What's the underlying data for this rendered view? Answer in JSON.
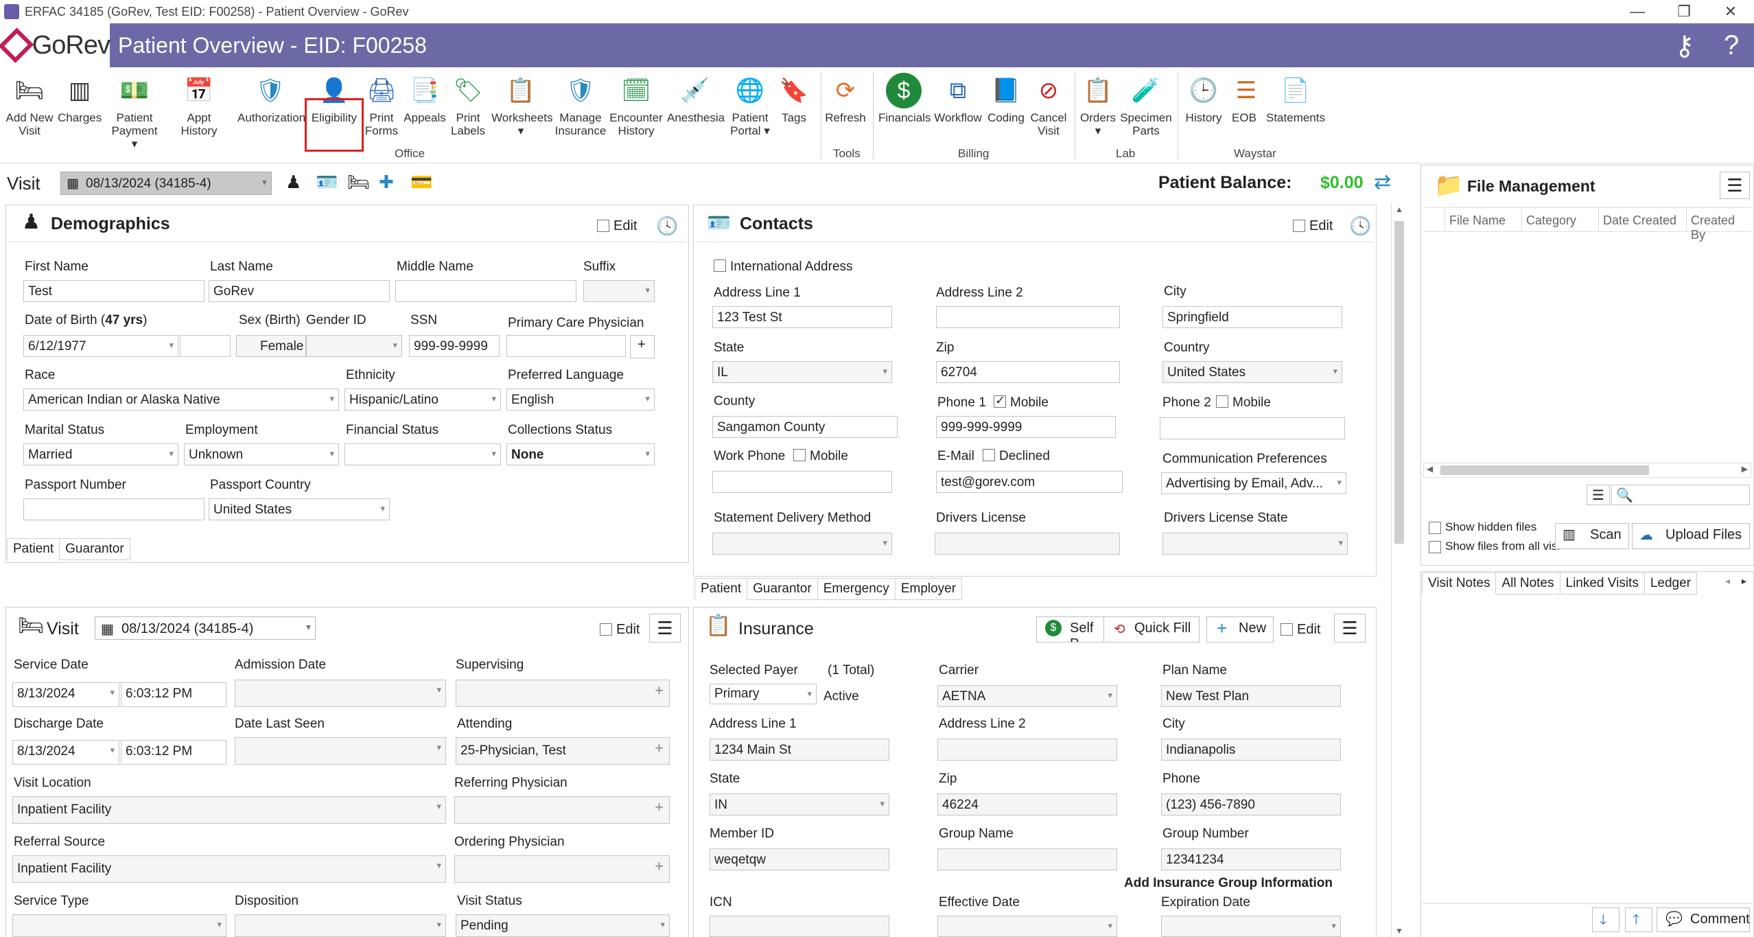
{
  "window": {
    "title": "ERFAC 34185 (GoRev, Test EID: F00258) - Patient Overview - GoRev",
    "minimize": "—",
    "restore": "❐",
    "close": "✕"
  },
  "header": {
    "logo": "GoRev",
    "title": "Patient Overview - EID: F00258"
  },
  "ribbon": {
    "office": [
      {
        "key": "add_new_visit",
        "label": "Add New Visit"
      },
      {
        "key": "charges",
        "label": "Charges"
      },
      {
        "key": "patient_payment",
        "label": "Patient Payment"
      },
      {
        "key": "appt_history",
        "label": "Appt History"
      },
      {
        "key": "authorization",
        "label": "Authorization"
      },
      {
        "key": "eligibility",
        "label": "Eligibility"
      },
      {
        "key": "print_forms",
        "label": "Print Forms"
      },
      {
        "key": "appeals",
        "label": "Appeals"
      },
      {
        "key": "print_labels",
        "label": "Print Labels"
      },
      {
        "key": "worksheets",
        "label": "Worksheets"
      },
      {
        "key": "manage_insurance",
        "label": "Manage Insurance"
      },
      {
        "key": "encounter_history",
        "label": "Encounter History"
      },
      {
        "key": "anesthesia",
        "label": "Anesthesia"
      },
      {
        "key": "patient_portal",
        "label": "Patient Portal"
      },
      {
        "key": "tags",
        "label": "Tags"
      }
    ],
    "tools": [
      {
        "key": "refresh",
        "label": "Refresh"
      }
    ],
    "billing": [
      {
        "key": "financials",
        "label": "Financials"
      },
      {
        "key": "workflow",
        "label": "Workflow"
      },
      {
        "key": "coding",
        "label": "Coding"
      },
      {
        "key": "cancel_visit",
        "label": "Cancel Visit"
      }
    ],
    "lab": [
      {
        "key": "orders",
        "label": "Orders"
      },
      {
        "key": "specimen_parts",
        "label": "Specimen Parts"
      }
    ],
    "waystar": [
      {
        "key": "history",
        "label": "History"
      },
      {
        "key": "eob",
        "label": "EOB"
      },
      {
        "key": "statements",
        "label": "Statements"
      }
    ],
    "groups": {
      "office": "Office",
      "tools": "Tools",
      "billing": "Billing",
      "lab": "Lab",
      "waystar": "Waystar"
    }
  },
  "visitbar": {
    "label": "Visit",
    "selected": "08/13/2024 (34185-4)",
    "balance_label": "Patient Balance:",
    "balance_value": "$0.00"
  },
  "demographics": {
    "title": "Demographics",
    "edit": "Edit",
    "first_name_label": "First Name",
    "first_name": "Test",
    "last_name_label": "Last Name",
    "last_name": "GoRev",
    "middle_name_label": "Middle Name",
    "middle_name": "",
    "suffix_label": "Suffix",
    "suffix": "",
    "dob_label": "Date of Birth (",
    "age": "47 yrs",
    "dob_label_end": ")",
    "dob": "6/12/1977",
    "sex_label": "Sex (Birth)",
    "sex": "Female",
    "gender_label": "Gender ID",
    "gender": "",
    "ssn_label": "SSN",
    "ssn": "999-99-9999",
    "pcp_label": "Primary Care Physician",
    "pcp": "",
    "pcp_add": "+",
    "race_label": "Race",
    "race": "American Indian or Alaska Native",
    "ethnicity_label": "Ethnicity",
    "ethnicity": "Hispanic/Latino",
    "language_label": "Preferred Language",
    "language": "English",
    "marital_label": "Marital Status",
    "marital": "Married",
    "employment_label": "Employment",
    "employment": "Unknown",
    "financial_label": "Financial Status",
    "financial": "",
    "collections_label": "Collections Status",
    "collections": "None",
    "passport_label": "Passport Number",
    "passport": "",
    "passport_country_label": "Passport Country",
    "passport_country": "United States",
    "tabs": [
      "Patient",
      "Guarantor"
    ]
  },
  "contacts": {
    "title": "Contacts",
    "edit": "Edit",
    "intl_label": "International Address",
    "addr1_label": "Address Line 1",
    "addr1": "123 Test St",
    "addr2_label": "Address Line 2",
    "addr2": "",
    "city_label": "City",
    "city": "Springfield",
    "state_label": "State",
    "state": "IL",
    "zip_label": "Zip",
    "zip": "62704",
    "country_label": "Country",
    "country": "United States",
    "county_label": "County",
    "county": "Sangamon County",
    "phone1_label": "Phone 1",
    "phone1_mobile": "Mobile",
    "phone1": "999-999-9999",
    "phone2_label": "Phone 2",
    "phone2_mobile": "Mobile",
    "phone2": "",
    "work_label": "Work Phone",
    "work_mobile": "Mobile",
    "work": "",
    "email_label": "E-Mail",
    "email_declined": "Declined",
    "email": "test@gorev.com",
    "comm_label": "Communication Preferences",
    "comm": "Advertising by Email, Adv...",
    "stmt_label": "Statement Delivery Method",
    "stmt": "",
    "dl_label": "Drivers License",
    "dl": "",
    "dl_state_label": "Drivers License State",
    "dl_state": "",
    "tabs": [
      "Patient",
      "Guarantor",
      "Emergency",
      "Employer"
    ]
  },
  "visit": {
    "title": "Visit",
    "selected": "08/13/2024 (34185-4)",
    "edit": "Edit",
    "service_date_label": "Service Date",
    "service_date": "8/13/2024",
    "service_time": "6:03:12 PM",
    "admission_label": "Admission Date",
    "admission": "",
    "supervising_label": "Supervising",
    "supervising": "",
    "discharge_label": "Discharge Date",
    "discharge_date": "8/13/2024",
    "discharge_time": "6:03:12 PM",
    "last_seen_label": "Date Last Seen",
    "last_seen": "",
    "attending_label": "Attending",
    "attending": "25-Physician, Test",
    "location_label": "Visit Location",
    "location": "Inpatient Facility",
    "referring_label": "Referring Physician",
    "referring": "",
    "referral_label": "Referral Source",
    "referral": "Inpatient Facility",
    "ordering_label": "Ordering Physician",
    "ordering": "",
    "service_type_label": "Service Type",
    "service_type": "",
    "disposition_label": "Disposition",
    "disposition": "",
    "status_label": "Visit Status",
    "status": "Pending"
  },
  "insurance": {
    "title": "Insurance",
    "self_pay": "Self P",
    "quick_fill": "Quick Fill",
    "new": "New",
    "edit": "Edit",
    "payer_label": "Selected Payer",
    "payer_total": "(1 Total)",
    "payer": "Primary",
    "payer_status": "Active",
    "carrier_label": "Carrier",
    "carrier": "AETNA",
    "plan_label": "Plan Name",
    "plan": "New Test Plan",
    "addr1_label": "Address Line 1",
    "addr1": "1234 Main St",
    "addr2_label": "Address Line 2",
    "addr2": "",
    "city_label": "City",
    "city": "Indianapolis",
    "state_label": "State",
    "state": "IN",
    "zip_label": "Zip",
    "zip": "46224",
    "phone_label": "Phone",
    "phone": "(123) 456-7890",
    "member_label": "Member ID",
    "member": "weqetqw",
    "group_name_label": "Group Name",
    "group_name": "",
    "group_number_label": "Group Number",
    "group_number": "12341234",
    "add_group": "Add Insurance Group Information",
    "icn_label": "ICN",
    "icn": "",
    "effective_label": "Effective Date",
    "effective": "",
    "expiration_label": "Expiration Date",
    "expiration": ""
  },
  "file_mgmt": {
    "title": "File Management",
    "columns": [
      "File Name",
      "Category",
      "Date Created",
      "Created By"
    ],
    "show_hidden": "Show hidden files",
    "show_all": "Show files from all visits",
    "scan": "Scan",
    "upload": "Upload Files",
    "search_placeholder": ""
  },
  "notes": {
    "tabs": [
      "Visit Notes",
      "All Notes",
      "Linked Visits",
      "Ledger"
    ],
    "comment": "Comment"
  },
  "colors": {
    "header": "#6b6aa6",
    "balance": "#2fbf2f",
    "eligibility_highlight": "#e02020"
  }
}
